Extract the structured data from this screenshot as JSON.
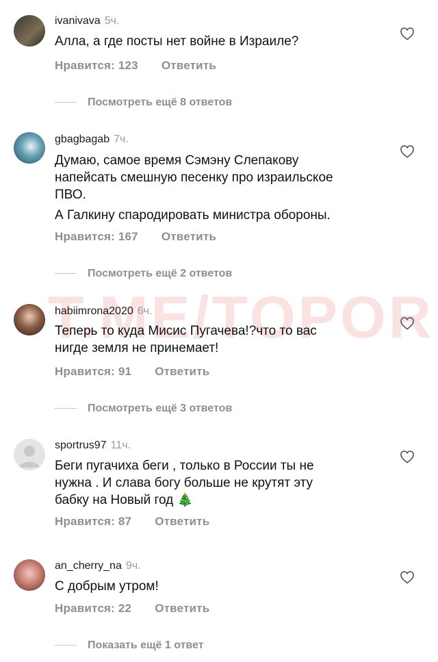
{
  "watermark": "T.ME/TOPOR",
  "comments": [
    {
      "username": "ivanivava",
      "time": "5ч.",
      "text": [
        "Алла, а где посты нет войне в Израиле?"
      ],
      "likes": "Нравится: 123",
      "reply": "Ответить",
      "more_replies": "Посмотреть ещё 8 ответов"
    },
    {
      "username": "gbagbagab",
      "time": "7ч.",
      "text": [
        "Думаю, самое время Сэмэну Слепакову",
        "напейсать смешную песенку про израильское",
        "ПВО.",
        "А Галкину спародировать министра обороны."
      ],
      "likes": "Нравится: 167",
      "reply": "Ответить",
      "more_replies": "Посмотреть ещё 2 ответов"
    },
    {
      "username": "habiimrona2020",
      "time": "6ч.",
      "text": [
        "Теперь то куда Мисис Пугачева!?что то вас",
        "нигде земля не принемает!"
      ],
      "likes": "Нравится: 91",
      "reply": "Ответить",
      "more_replies": "Посмотреть ещё 3 ответов"
    },
    {
      "username": "sportrus97",
      "time": "11ч.",
      "text": [
        "Беги пугачиха беги , только в России ты не",
        "нужна . И слава богу больше не крутят эту",
        "бабку на Новый год 🎄"
      ],
      "likes": "Нравится: 87",
      "reply": "Ответить"
    },
    {
      "username": "an_cherry_na",
      "time": "9ч.",
      "text": [
        "С добрым утром!"
      ],
      "likes": "Нравится: 22",
      "reply": "Ответить",
      "more_replies": "Показать ещё 1 ответ"
    }
  ],
  "icons": {
    "like": "heart-outline-icon"
  }
}
